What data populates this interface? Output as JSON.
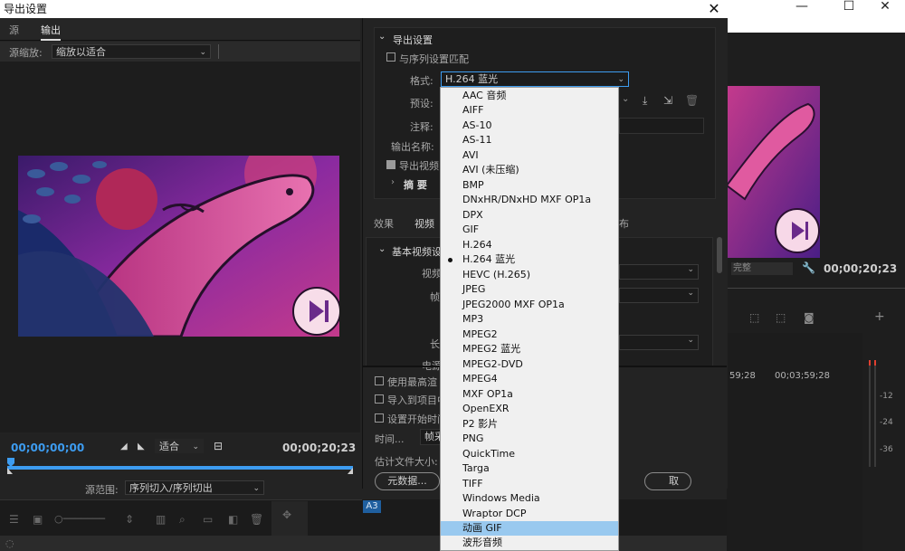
{
  "dialog": {
    "title": "导出设置",
    "close_glyph": "✕"
  },
  "background_window": {
    "min_glyph": "—",
    "max_glyph": "☐",
    "close_glyph": "✕",
    "timecode": "00;00;20;23",
    "zoom_label": "完整",
    "ruler_times": [
      "59;28",
      "00;03;59;28"
    ],
    "meter_ticks": [
      "-12",
      "-24",
      "-36"
    ]
  },
  "left": {
    "tabs": [
      "源",
      "输出"
    ],
    "zoom_label": "源缩放:",
    "zoom_value": "缩放以适合",
    "timecode_current": "00;00;00;00",
    "fit_value": "适合",
    "timecode_duration": "00;00;20;23",
    "range_label": "源范围:",
    "range_value": "序列切入/序列切出"
  },
  "right": {
    "export_settings_header": "导出设置",
    "match_sequence_label": "与序列设置匹配",
    "format_label": "格式:",
    "format_value": "H.264 蓝光",
    "preset_label": "预设:",
    "comment_label": "注释:",
    "output_name_label": "输出名称:",
    "export_video_label": "导出视频",
    "summary_label": "摘 要",
    "tabs": [
      "效果",
      "视频",
      "布"
    ],
    "basic_video_header": "基本视频设",
    "field_video": "视频",
    "field_frame": "帧",
    "field_length": "长",
    "field_e": "电源",
    "use_max_render": "使用最高渲",
    "import_into_project": "导入到项目中",
    "set_start_time": "设置开始时间",
    "time_label": "时间...",
    "frame_label": "帧采",
    "estimated_size": "估计文件大小:",
    "metadata_button": "元数据...",
    "cancel_button": "取"
  },
  "format_list": {
    "items": [
      "AAC 音频",
      "AIFF",
      "AS-10",
      "AS-11",
      "AVI",
      "AVI (未压缩)",
      "BMP",
      "DNxHR/DNxHD MXF OP1a",
      "DPX",
      "GIF",
      "H.264",
      "H.264 蓝光",
      "HEVC (H.265)",
      "JPEG",
      "JPEG2000 MXF OP1a",
      "MP3",
      "MPEG2",
      "MPEG2 蓝光",
      "MPEG2-DVD",
      "MPEG4",
      "MXF OP1a",
      "OpenEXR",
      "P2 影片",
      "PNG",
      "QuickTime",
      "Targa",
      "TIFF",
      "Windows Media",
      "Wraptor DCP",
      "动画 GIF",
      "波形音频"
    ],
    "selected": "H.264 蓝光",
    "highlighted": "动画 GIF"
  },
  "bottom_strip": {
    "track_label": "A3"
  },
  "colors": {
    "accent_blue": "#3d9cf0",
    "highlight": "#99c9ef",
    "panel": "#232323"
  }
}
